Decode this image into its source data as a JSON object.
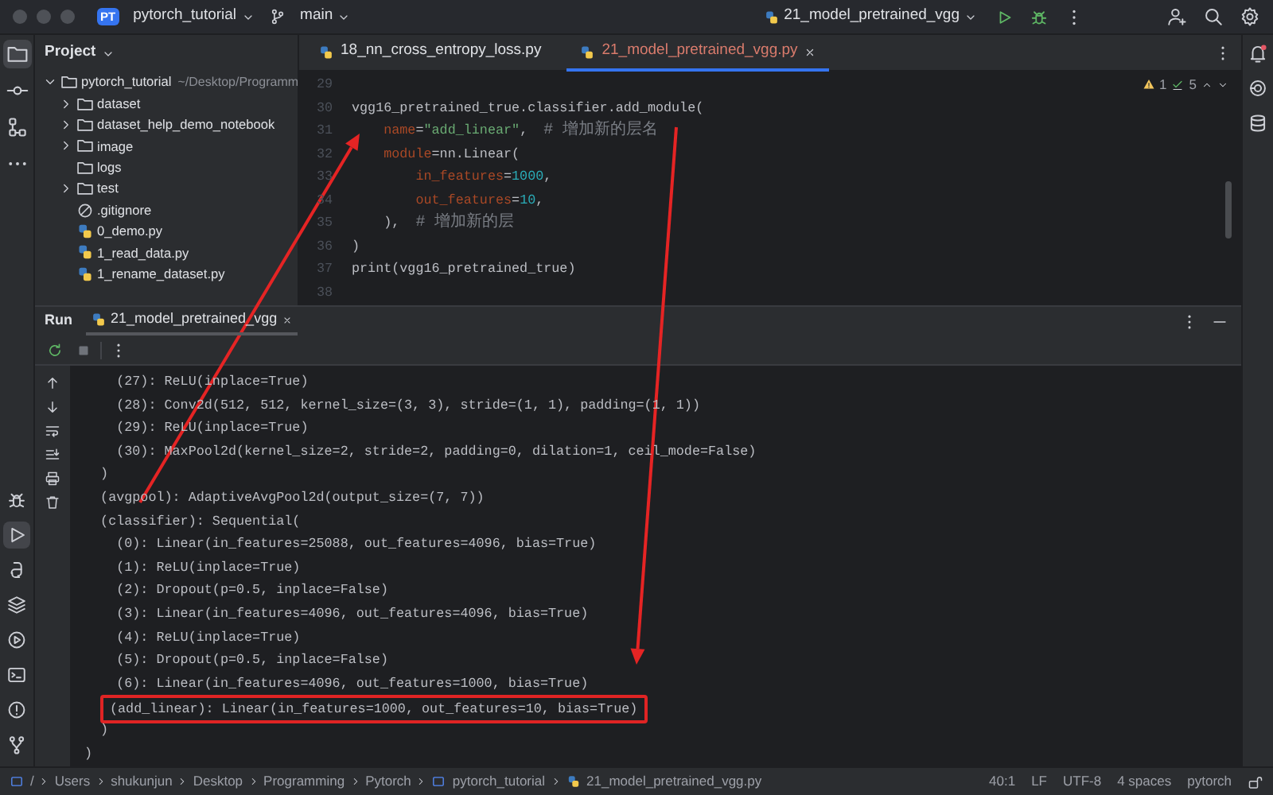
{
  "title_bar": {
    "project_badge": "PT",
    "project": "pytorch_tutorial",
    "branch": "main",
    "run_config": "21_model_pretrained_vgg"
  },
  "left_toolbar": {
    "top": [
      {
        "selected": true
      },
      {
        "selected": false
      },
      {
        "selected": false
      },
      {
        "selected": false
      }
    ],
    "bottom": [
      {
        "selected": false
      },
      {
        "selected": true
      },
      {
        "selected": false
      },
      {
        "selected": false
      },
      {
        "selected": false
      },
      {
        "selected": false
      },
      {
        "selected": false
      },
      {
        "selected": false
      }
    ]
  },
  "project_panel": {
    "title": "Project",
    "tree": [
      {
        "kind": "folder",
        "name": "pytorch_tutorial",
        "path": "~/Desktop/Programm",
        "expanded": true,
        "children": [
          {
            "kind": "folder",
            "name": "dataset",
            "expanded": false
          },
          {
            "kind": "folder",
            "name": "dataset_help_demo_notebook",
            "expanded": false
          },
          {
            "kind": "folder",
            "name": "image",
            "expanded": false
          },
          {
            "kind": "empty_folder",
            "name": "logs"
          },
          {
            "kind": "folder",
            "name": "test",
            "expanded": false
          },
          {
            "kind": "ignore",
            "name": ".gitignore"
          },
          {
            "kind": "python",
            "name": "0_demo.py"
          },
          {
            "kind": "python",
            "name": "1_read_data.py"
          },
          {
            "kind": "python",
            "name": "1_rename_dataset.py"
          }
        ]
      }
    ]
  },
  "editor": {
    "tabs": [
      {
        "label": "18_nn_cross_entropy_loss.py",
        "selected": false
      },
      {
        "label": "21_model_pretrained_vgg.py",
        "selected": true
      }
    ],
    "inspections": {
      "warnings": "1",
      "passed": "5"
    },
    "lines": [
      {
        "number": "29"
      },
      {
        "number": "30",
        "segments": [
          {
            "kind": "plain",
            "text": "vgg16_pretrained_true.classifier.add_module("
          }
        ]
      },
      {
        "number": "31",
        "segments": [
          {
            "kind": "kwarg",
            "text": "    name"
          },
          {
            "kind": "plain",
            "text": "="
          },
          {
            "kind": "string",
            "text": "\"add_linear\""
          },
          {
            "kind": "plain",
            "text": ",  "
          },
          {
            "kind": "comment",
            "text": "# 增加新的层名"
          }
        ]
      },
      {
        "number": "32",
        "segments": [
          {
            "kind": "kwarg",
            "text": "    module"
          },
          {
            "kind": "plain",
            "text": "=nn.Linear("
          }
        ]
      },
      {
        "number": "33",
        "segments": [
          {
            "kind": "kwarg",
            "text": "        in_features"
          },
          {
            "kind": "plain",
            "text": "="
          },
          {
            "kind": "number",
            "text": "1000"
          },
          {
            "kind": "plain",
            "text": ","
          }
        ]
      },
      {
        "number": "34",
        "segments": [
          {
            "kind": "kwarg",
            "text": "        out_features"
          },
          {
            "kind": "plain",
            "text": "="
          },
          {
            "kind": "number",
            "text": "10"
          },
          {
            "kind": "plain",
            "text": ","
          }
        ]
      },
      {
        "number": "35",
        "segments": [
          {
            "kind": "plain",
            "text": "    ),  "
          },
          {
            "kind": "comment",
            "text": "# 增加新的层"
          }
        ]
      },
      {
        "number": "36",
        "segments": [
          {
            "kind": "plain",
            "text": ")"
          }
        ]
      },
      {
        "number": "37",
        "segments": [
          {
            "kind": "plain",
            "text": "print(vgg16_pretrained_true)"
          }
        ]
      },
      {
        "number": "38"
      }
    ]
  },
  "run_panel": {
    "title": "Run",
    "tabs": [
      {
        "label": "21_model_pretrained_vgg",
        "selected": true
      }
    ],
    "output": [
      {
        "text": "    (27): ReLU(inplace=True)",
        "highlighted": false
      },
      {
        "text": "    (28): Conv2d(512, 512, kernel_size=(3, 3), stride=(1, 1), padding=(1, 1))",
        "highlighted": false
      },
      {
        "text": "    (29): ReLU(inplace=True)",
        "highlighted": false
      },
      {
        "text": "    (30): MaxPool2d(kernel_size=2, stride=2, padding=0, dilation=1, ceil_mode=False)",
        "highlighted": false
      },
      {
        "text": "  )",
        "highlighted": false
      },
      {
        "text": "  (avgpool): AdaptiveAvgPool2d(output_size=(7, 7))",
        "highlighted": false
      },
      {
        "text": "  (classifier): Sequential(",
        "highlighted": false
      },
      {
        "text": "    (0): Linear(in_features=25088, out_features=4096, bias=True)",
        "highlighted": false
      },
      {
        "text": "    (1): ReLU(inplace=True)",
        "highlighted": false
      },
      {
        "text": "    (2): Dropout(p=0.5, inplace=False)",
        "highlighted": false
      },
      {
        "text": "    (3): Linear(in_features=4096, out_features=4096, bias=True)",
        "highlighted": false
      },
      {
        "text": "    (4): ReLU(inplace=True)",
        "highlighted": false
      },
      {
        "text": "    (5): Dropout(p=0.5, inplace=False)",
        "highlighted": false
      },
      {
        "text": "    (6): Linear(in_features=4096, out_features=1000, bias=True)",
        "highlighted": false
      },
      {
        "text": "(add_linear): Linear(in_features=1000, out_features=10, bias=True)",
        "highlighted": true
      },
      {
        "text": "  )",
        "highlighted": false
      },
      {
        "text": ")",
        "highlighted": false
      }
    ]
  },
  "status_bar": {
    "breadcrumbs": [
      {
        "kind": "module",
        "label": "/"
      },
      {
        "kind": "folder",
        "label": "Users"
      },
      {
        "kind": "folder",
        "label": "shukunjun"
      },
      {
        "kind": "folder",
        "label": "Desktop"
      },
      {
        "kind": "folder",
        "label": "Programming"
      },
      {
        "kind": "folder",
        "label": "Pytorch"
      },
      {
        "kind": "module",
        "label": "pytorch_tutorial"
      },
      {
        "kind": "python",
        "label": "21_model_pretrained_vgg.py"
      }
    ],
    "position": "40:1",
    "line_ending": "LF",
    "encoding": "UTF-8",
    "indent": "4 spaces",
    "interpreter": "pytorch"
  },
  "annotations": [
    {
      "kind": "arrow"
    },
    {
      "kind": "arrow"
    }
  ]
}
